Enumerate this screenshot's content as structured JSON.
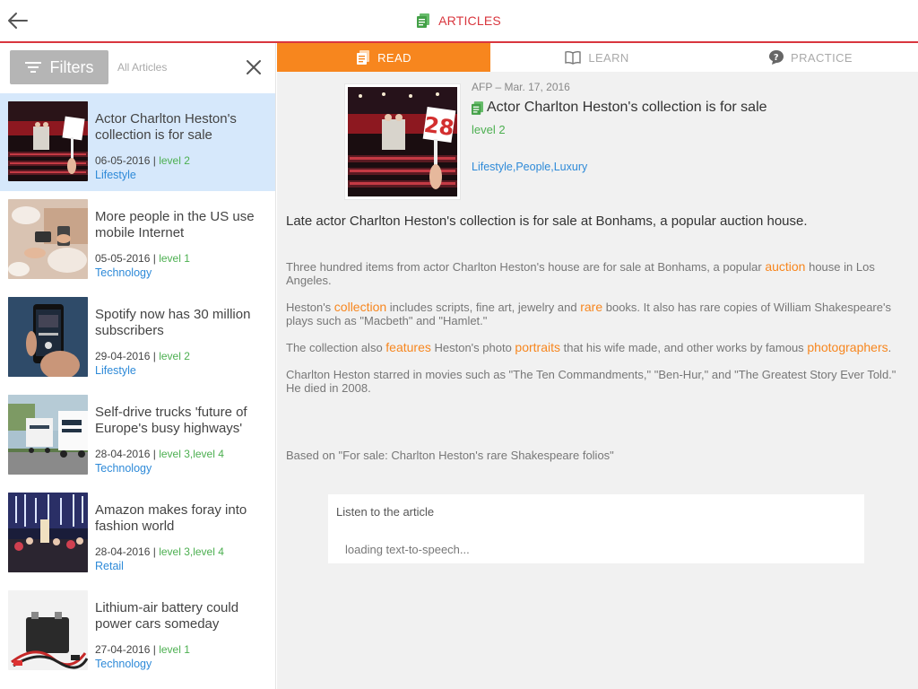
{
  "header": {
    "title": "ARTICLES",
    "back_icon": "back-arrow-icon",
    "accent_color": "#d9363e"
  },
  "sidebar": {
    "filters_label": "Filters",
    "scope_label": "All Articles",
    "items": [
      {
        "title": "Actor Charlton Heston's collection is for sale",
        "date": "06-05-2016",
        "level": "level 2",
        "category": "Lifestyle",
        "active": true
      },
      {
        "title": "More people in the US use mobile Internet",
        "date": "05-05-2016",
        "level": "level 1",
        "category": "Technology"
      },
      {
        "title": "Spotify now has 30 million subscribers",
        "date": "29-04-2016",
        "level": "level 2",
        "category": "Lifestyle"
      },
      {
        "title": "Self-drive trucks 'future of Europe's busy highways'",
        "date": "28-04-2016",
        "level": "level 3,level 4",
        "category": "Technology"
      },
      {
        "title": "Amazon makes foray into fashion world",
        "date": "28-04-2016",
        "level": "level 3,level 4",
        "category": "Retail"
      },
      {
        "title": "Lithium-air battery could power cars someday",
        "date": "27-04-2016",
        "level": "level 1",
        "category": "Technology"
      }
    ]
  },
  "tabs": [
    {
      "label": "READ",
      "active": true
    },
    {
      "label": "LEARN"
    },
    {
      "label": "PRACTICE"
    }
  ],
  "article": {
    "source": "AFP – Mar. 17, 2016",
    "title": "Actor Charlton Heston's collection is for sale",
    "level": "level 2",
    "tags": "Lifestyle,People,Luxury",
    "lead": "Late actor Charlton Heston's collection is for sale at Bonhams, a popular auction house.",
    "p1_a": "Three hundred items from actor Charlton Heston's house are for sale at Bonhams, a popular ",
    "p1_kw": "auction",
    "p1_b": " house in Los Angeles.",
    "p2_a": "Heston's ",
    "p2_kw1": "collection",
    "p2_b": " includes scripts, fine art, jewelry and ",
    "p2_kw2": "rare",
    "p2_c": " books. It also has rare copies of William Shakespeare's plays such as \"Macbeth\" and \"Hamlet.\"",
    "p3_a": "The collection also ",
    "p3_kw1": "features",
    "p3_b": " Heston's photo ",
    "p3_kw2": "portraits",
    "p3_c": " that his wife made, and other works by famous ",
    "p3_kw3": "photographers",
    "p3_d": ".",
    "p4": "Charlton Heston starred in movies such as \"The Ten Commandments,\" \"Ben-Hur,\" and \"The Greatest Story Ever Told.\" He died in 2008.",
    "based_on": "Based on \"For sale: Charlton Heston's rare Shakespeare folios\"",
    "auction_sign": "28"
  },
  "listen": {
    "title": "Listen to the article",
    "status": "loading text-to-speech..."
  },
  "colors": {
    "tab_active": "#f7861e",
    "level": "#4caf50",
    "category": "#2e8ad8",
    "keyword": "#f7861e",
    "selected_row": "#d6e8fb"
  }
}
